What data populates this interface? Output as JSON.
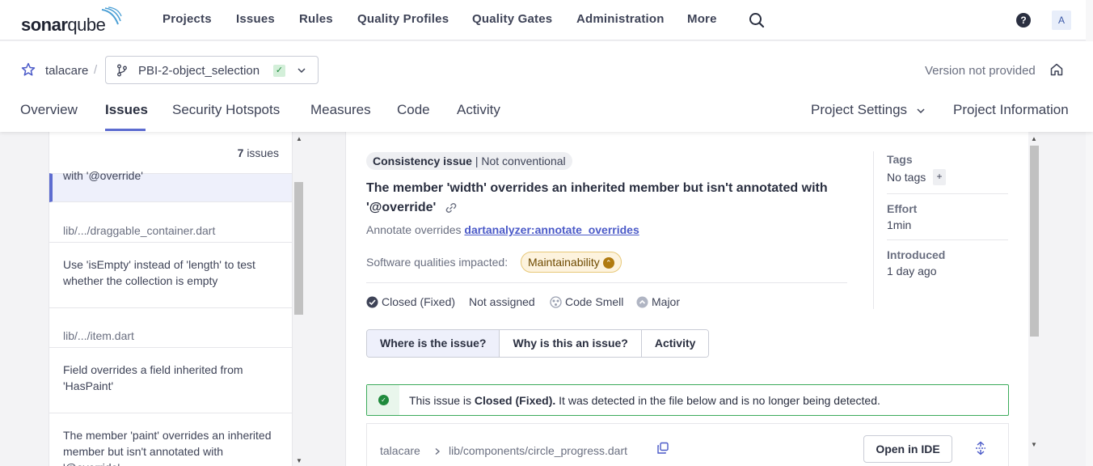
{
  "brand": {
    "name_bold": "sonar",
    "name_light": "qube"
  },
  "topnav": {
    "items": [
      "Projects",
      "Issues",
      "Rules",
      "Quality Profiles",
      "Quality Gates",
      "Administration",
      "More"
    ],
    "help_label": "?",
    "avatar_letter": "A"
  },
  "project": {
    "name": "talacare",
    "separator": "/",
    "branch": "PBI-2-object_selection",
    "branch_status": "✓",
    "version": "Version not provided",
    "tabs": [
      "Overview",
      "Issues",
      "Security Hotspots",
      "Measures",
      "Code",
      "Activity"
    ],
    "active_tab": "Issues",
    "settings_label": "Project Settings",
    "info_label": "Project Information"
  },
  "issue_list": {
    "count": "7",
    "count_suffix": "issues",
    "selected_tail": "with '@override'",
    "groups": [
      {
        "file": "lib/.../draggable_container.dart",
        "items": [
          "Use 'isEmpty' instead of 'length' to test whether the collection is empty"
        ]
      },
      {
        "file": "lib/.../item.dart",
        "items": [
          "Field overrides a field inherited from 'HasPaint'",
          "The member 'paint' overrides an inherited member but isn't annotated with '@override'"
        ]
      }
    ]
  },
  "issue": {
    "clean_code_attribute": "Consistency issue",
    "clean_code_divider": "|",
    "clean_code_detail": "Not conventional",
    "title": "The member 'width' overrides an inherited member but isn't annotated with '@override'",
    "rule_prefix": "Annotate overrides",
    "rule_key": "dartanalyzer:annotate_overrides",
    "qualities_label": "Software qualities impacted:",
    "quality": "Maintainability",
    "status": "Closed (Fixed)",
    "assignee": "Not assigned",
    "type": "Code Smell",
    "severity": "Major",
    "tabs": [
      "Where is the issue?",
      "Why is this an issue?",
      "Activity"
    ],
    "alert": {
      "prefix": "This issue is",
      "status": "Closed (Fixed).",
      "suffix": "It was detected in the file below and is no longer being detected."
    },
    "code_crumb_project": "talacare",
    "code_crumb_file": "lib/components/circle_progress.dart",
    "open_ide": "Open in IDE",
    "tags_label": "Tags",
    "tags_value": "No tags",
    "tags_add": "+",
    "effort_label": "Effort",
    "effort_value": "1min",
    "introduced_label": "Introduced",
    "introduced_value": "1 day ago"
  },
  "colors": {
    "accent": "#5d6cd0",
    "success": "#1f8a3c",
    "maintainability_bg": "#fdf3de"
  }
}
